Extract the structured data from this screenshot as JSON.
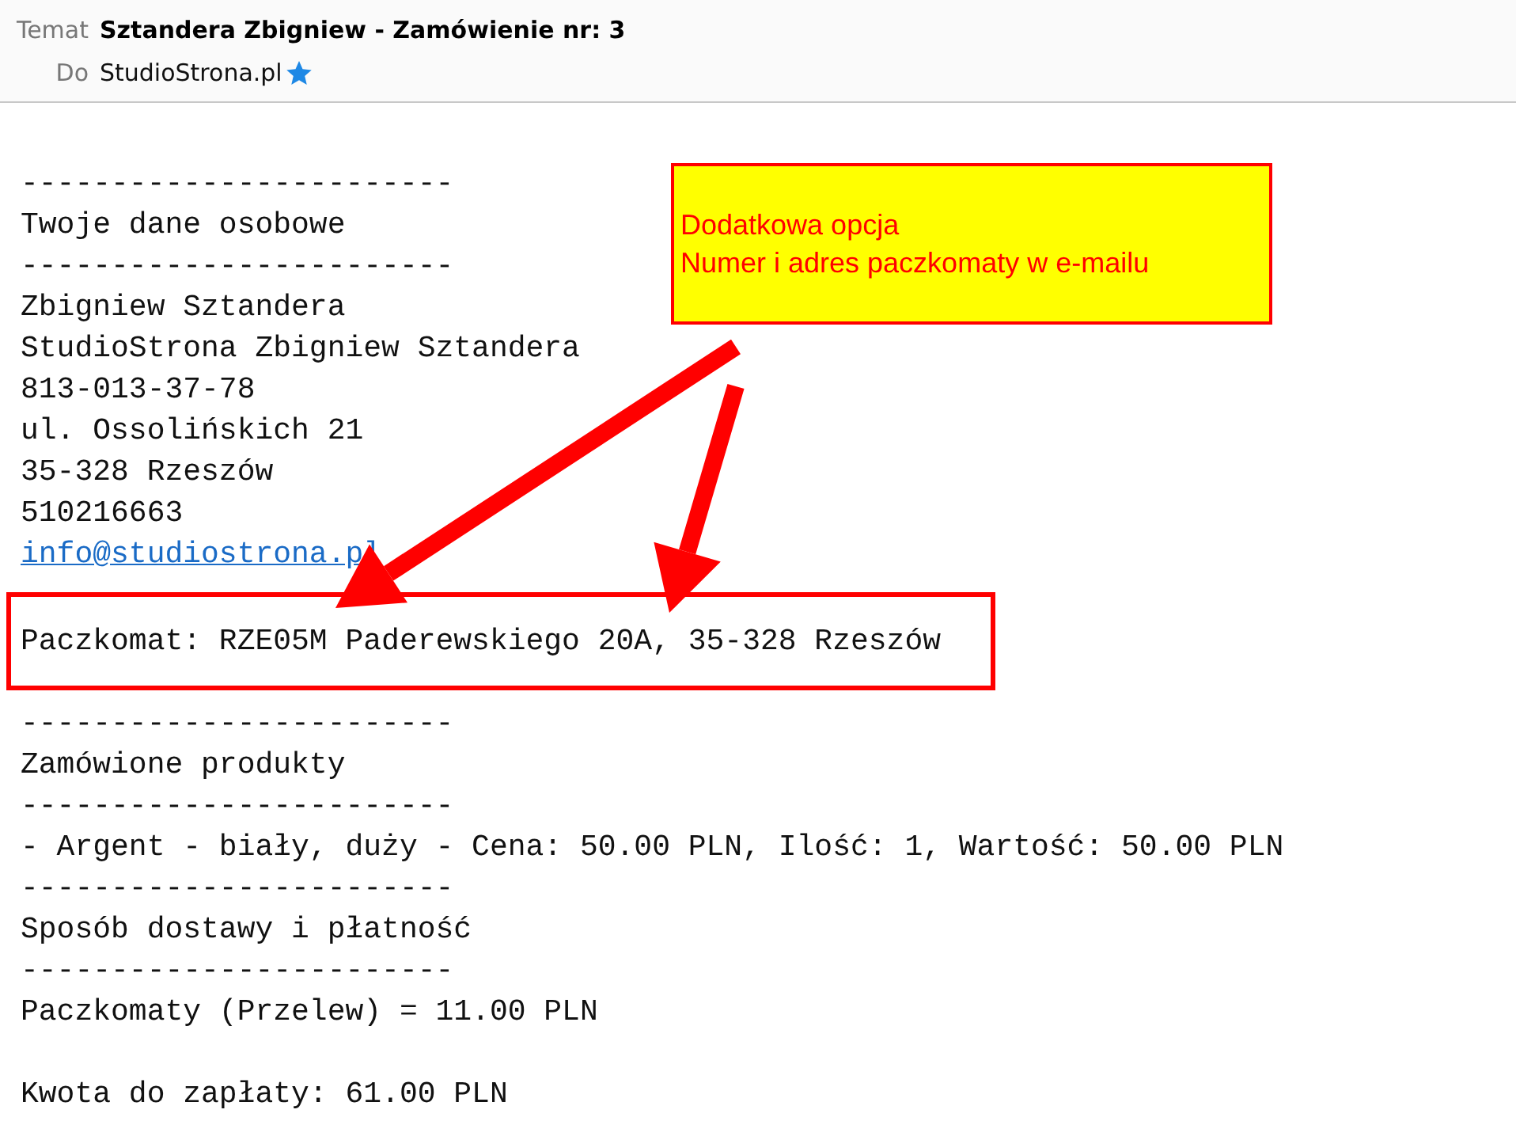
{
  "header": {
    "subject_label": "Temat",
    "subject": "Sztandera Zbigniew - Zamówienie nr: 3",
    "to_label": "Do",
    "to": "StudioStrona.pl",
    "to_starred": true
  },
  "callout": {
    "lines": [
      "Dodatkowa opcja",
      "Numer i adres paczkomaty w e-mailu"
    ]
  },
  "body": [
    {
      "kind": "text",
      "text": "------------------------",
      "space_before": false
    },
    {
      "kind": "text",
      "text": "Twoje dane osobowe",
      "space_before": false
    },
    {
      "kind": "text",
      "text": "------------------------",
      "space_before": false
    },
    {
      "kind": "text",
      "text": "Zbigniew Sztandera",
      "space_before": false
    },
    {
      "kind": "text",
      "text": "StudioStrona Zbigniew Sztandera",
      "space_before": false
    },
    {
      "kind": "text",
      "text": "813-013-37-78",
      "space_before": false
    },
    {
      "kind": "text",
      "text": "ul. Ossolińskich 21",
      "space_before": false
    },
    {
      "kind": "text",
      "text": "35-328 Rzeszów",
      "space_before": false
    },
    {
      "kind": "text",
      "text": "510216663",
      "space_before": false
    },
    {
      "kind": "link",
      "text": "info@studiostrona.pl",
      "space_before": false
    },
    {
      "kind": "boxed",
      "text": "Paczkomat: RZE05M Paderewskiego 20A, 35-328 Rzeszów",
      "space_before": false
    },
    {
      "kind": "text",
      "text": "------------------------",
      "space_before": false
    },
    {
      "kind": "text",
      "text": "Zamówione produkty",
      "space_before": false
    },
    {
      "kind": "text",
      "text": "------------------------",
      "space_before": false
    },
    {
      "kind": "text",
      "text": "- Argent - biały, duży - Cena: 50.00 PLN, Ilość: 1, Wartość: 50.00 PLN",
      "space_before": false
    },
    {
      "kind": "text",
      "text": "------------------------",
      "space_before": false
    },
    {
      "kind": "text",
      "text": "Sposób dostawy i płatność",
      "space_before": false
    },
    {
      "kind": "text",
      "text": "------------------------",
      "space_before": false
    },
    {
      "kind": "text",
      "text": "Paczkomaty (Przelew) = 11.00 PLN",
      "space_before": false
    },
    {
      "kind": "text",
      "text": "Kwota do zapłaty: 61.00 PLN",
      "space_before": true
    }
  ]
}
